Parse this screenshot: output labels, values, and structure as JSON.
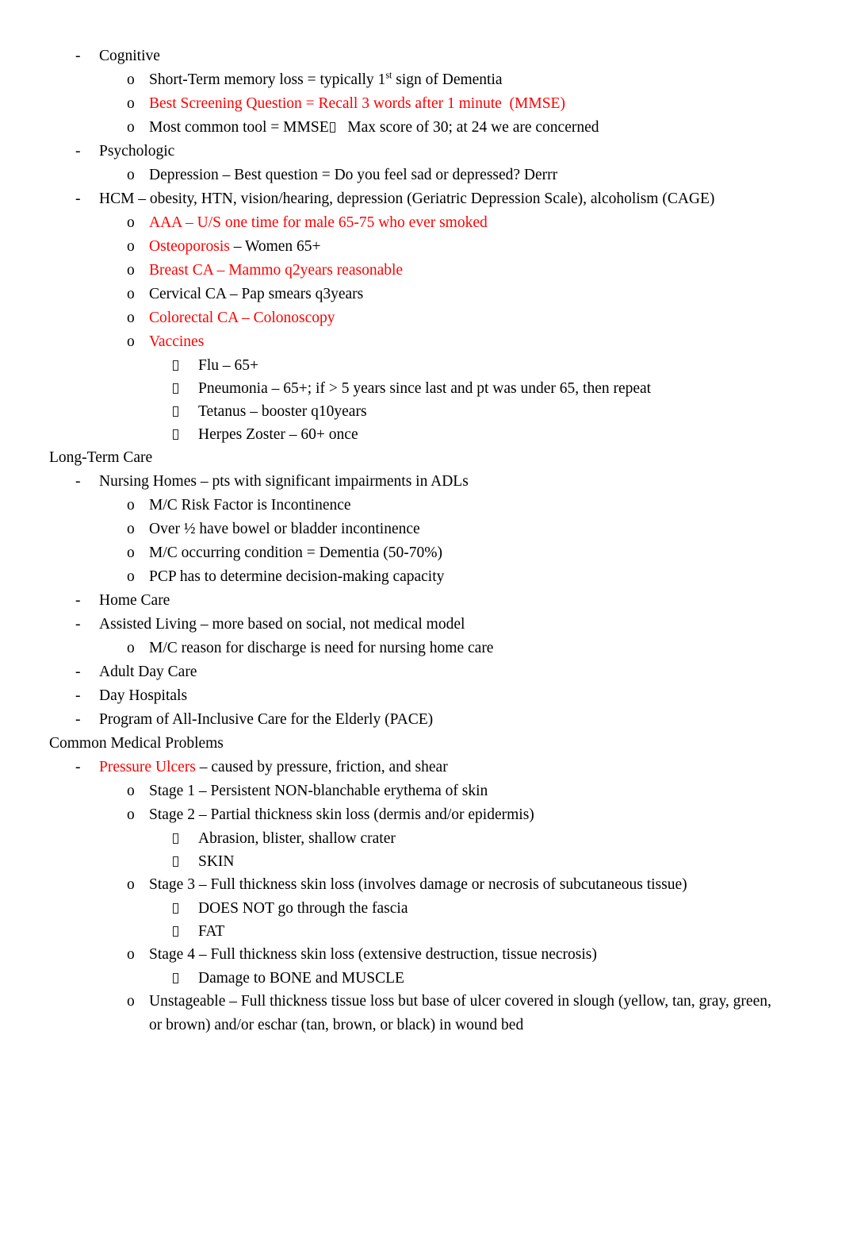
{
  "document": {
    "accent_red": "#FF0000",
    "text_black": "#000000",
    "background": "#FFFFFF",
    "missing_glyph_name": "missing-glyph-box"
  },
  "lines": [
    {
      "level": 1,
      "marker": "-",
      "name": "bullet-cognitive",
      "segments": [
        {
          "text": "Cognitive",
          "color": "black"
        }
      ]
    },
    {
      "level": 2,
      "marker": "o",
      "name": "bullet-short-term-memory-loss",
      "segments": [
        {
          "text": "Short-Term memory loss = typically 1",
          "color": "black"
        },
        {
          "text": "st",
          "color": "black",
          "sup": true
        },
        {
          "text": " sign of Dementia",
          "color": "black"
        }
      ]
    },
    {
      "level": 2,
      "marker": "o",
      "name": "bullet-best-screening-question",
      "segments": [
        {
          "text": "Best Screening Question = Recall 3 words after 1 minute  (MMSE)",
          "color": "red"
        }
      ]
    },
    {
      "level": 2,
      "marker": "o",
      "name": "bullet-most-common-tool-mmse",
      "segments": [
        {
          "text": "Most common tool = MMSE",
          "color": "black"
        },
        {
          "tofu": true
        },
        {
          "text": "   Max score of 30; at 24 we are concerned",
          "color": "black"
        }
      ]
    },
    {
      "level": 1,
      "marker": "-",
      "name": "bullet-psychologic",
      "segments": [
        {
          "text": "Psychologic",
          "color": "black"
        }
      ]
    },
    {
      "level": 2,
      "marker": "o",
      "name": "bullet-depression-best-question",
      "segments": [
        {
          "text": "Depression – Best question = Do you feel sad or depressed? Derrr",
          "color": "black"
        }
      ]
    },
    {
      "level": 1,
      "marker": "-",
      "name": "bullet-hcm",
      "segments": [
        {
          "text": "HCM – obesity, HTN, vision/hearing, depression (Geriatric Depression Scale), alcoholism (CAGE)",
          "color": "black"
        }
      ]
    },
    {
      "level": 2,
      "marker": "o",
      "name": "bullet-aaa-screening",
      "segments": [
        {
          "text": "AAA – U/S one time for male 65-75 who ever smoked",
          "color": "red"
        }
      ]
    },
    {
      "level": 2,
      "marker": "o",
      "name": "bullet-osteoporosis",
      "segments": [
        {
          "text": "Osteoporosis ",
          "color": "red"
        },
        {
          "text": "– Women 65+",
          "color": "black"
        }
      ]
    },
    {
      "level": 2,
      "marker": "o",
      "name": "bullet-breast-ca",
      "segments": [
        {
          "text": "Breast CA – Mammo q2years reasonable",
          "color": "red"
        }
      ]
    },
    {
      "level": 2,
      "marker": "o",
      "name": "bullet-cervical-ca",
      "segments": [
        {
          "text": "Cervical CA – Pap smears q3years",
          "color": "black"
        }
      ]
    },
    {
      "level": 2,
      "marker": "o",
      "name": "bullet-colorectal-ca",
      "segments": [
        {
          "text": "Colorectal CA – Colonoscopy",
          "color": "red"
        }
      ]
    },
    {
      "level": 2,
      "marker": "o",
      "name": "bullet-vaccines",
      "segments": [
        {
          "text": "Vaccines",
          "color": "red"
        }
      ]
    },
    {
      "level": 3,
      "marker": "box",
      "name": "bullet-vaccine-flu",
      "segments": [
        {
          "text": "Flu – 65+",
          "color": "black"
        }
      ]
    },
    {
      "level": 3,
      "marker": "box",
      "name": "bullet-vaccine-pneumonia",
      "segments": [
        {
          "text": "Pneumonia – 65+; if > 5 years since last and pt was under 65, then repeat",
          "color": "black"
        }
      ]
    },
    {
      "level": 3,
      "marker": "box",
      "name": "bullet-vaccine-tetanus",
      "segments": [
        {
          "text": "Tetanus – booster q10years",
          "color": "black"
        }
      ]
    },
    {
      "level": 3,
      "marker": "box",
      "name": "bullet-vaccine-herpes-zoster",
      "segments": [
        {
          "text": "Herpes Zoster – 60+ once",
          "color": "black"
        }
      ]
    },
    {
      "level": 0,
      "marker": "",
      "name": "heading-long-term-care",
      "segments": [
        {
          "text": "Long-Term Care",
          "color": "black"
        }
      ]
    },
    {
      "level": 1,
      "marker": "-",
      "name": "bullet-nursing-homes",
      "segments": [
        {
          "text": "Nursing Homes – pts with significant impairments in ADLs",
          "color": "black"
        }
      ]
    },
    {
      "level": 2,
      "marker": "o",
      "name": "bullet-mc-risk-factor-incontinence",
      "segments": [
        {
          "text": "M/C Risk Factor is Incontinence",
          "color": "black"
        }
      ]
    },
    {
      "level": 2,
      "marker": "o",
      "name": "bullet-bowel-bladder-incontinence",
      "segments": [
        {
          "text": "Over ½ have bowel or bladder incontinence",
          "color": "black"
        }
      ]
    },
    {
      "level": 2,
      "marker": "o",
      "name": "bullet-mc-occurring-condition-dementia",
      "segments": [
        {
          "text": "M/C occurring condition = Dementia (50-70%)",
          "color": "black"
        }
      ]
    },
    {
      "level": 2,
      "marker": "o",
      "name": "bullet-pcp-decision-making-capacity",
      "segments": [
        {
          "text": "PCP has to determine decision-making capacity",
          "color": "black"
        }
      ]
    },
    {
      "level": 1,
      "marker": "-",
      "name": "bullet-home-care",
      "segments": [
        {
          "text": "Home Care",
          "color": "black"
        }
      ]
    },
    {
      "level": 1,
      "marker": "-",
      "name": "bullet-assisted-living",
      "segments": [
        {
          "text": "Assisted Living – more based on social, not medical model",
          "color": "black"
        }
      ]
    },
    {
      "level": 2,
      "marker": "o",
      "name": "bullet-mc-reason-for-discharge",
      "segments": [
        {
          "text": "M/C reason for discharge is need for nursing home care",
          "color": "black"
        }
      ]
    },
    {
      "level": 1,
      "marker": "-",
      "name": "bullet-adult-day-care",
      "segments": [
        {
          "text": "Adult Day Care",
          "color": "black"
        }
      ]
    },
    {
      "level": 1,
      "marker": "-",
      "name": "bullet-day-hospitals",
      "segments": [
        {
          "text": "Day Hospitals",
          "color": "black"
        }
      ]
    },
    {
      "level": 1,
      "marker": "-",
      "name": "bullet-pace-program",
      "segments": [
        {
          "text": "Program of All-Inclusive Care for the Elderly (PACE)",
          "color": "black"
        }
      ]
    },
    {
      "level": 0,
      "marker": "",
      "name": "heading-common-medical-problems",
      "segments": [
        {
          "text": "Common Medical Problems",
          "color": "black"
        }
      ]
    },
    {
      "level": 1,
      "marker": "-",
      "name": "bullet-pressure-ulcers",
      "segments": [
        {
          "text": "Pressure Ulcers",
          "color": "red"
        },
        {
          "text": " – caused by pressure, friction, and shear",
          "color": "black"
        }
      ]
    },
    {
      "level": 2,
      "marker": "o",
      "name": "bullet-stage-1",
      "segments": [
        {
          "text": "Stage 1 – Persistent NON-blanchable erythema of skin",
          "color": "black"
        }
      ]
    },
    {
      "level": 2,
      "marker": "o",
      "name": "bullet-stage-2",
      "segments": [
        {
          "text": "Stage 2 – Partial thickness skin loss (dermis and/or epidermis)",
          "color": "black"
        }
      ]
    },
    {
      "level": 3,
      "marker": "box",
      "name": "bullet-abrasion-blister-crater",
      "segments": [
        {
          "text": "Abrasion, blister, shallow crater",
          "color": "black"
        }
      ]
    },
    {
      "level": 3,
      "marker": "box",
      "name": "bullet-skin",
      "segments": [
        {
          "text": "SKIN",
          "color": "black"
        }
      ]
    },
    {
      "level": 2,
      "marker": "o",
      "name": "bullet-stage-3",
      "segments": [
        {
          "text": "Stage 3 – Full thickness skin loss (involves damage or necrosis of subcutaneous tissue)",
          "color": "black"
        }
      ]
    },
    {
      "level": 3,
      "marker": "box",
      "name": "bullet-does-not-go-through-fascia",
      "segments": [
        {
          "text": "DOES NOT go through the fascia",
          "color": "black"
        }
      ]
    },
    {
      "level": 3,
      "marker": "box",
      "name": "bullet-fat",
      "segments": [
        {
          "text": "FAT",
          "color": "black"
        }
      ]
    },
    {
      "level": 2,
      "marker": "o",
      "name": "bullet-stage-4",
      "segments": [
        {
          "text": "Stage 4 – Full thickness skin loss (extensive destruction, tissue necrosis)",
          "color": "black"
        }
      ]
    },
    {
      "level": 3,
      "marker": "box",
      "name": "bullet-damage-to-bone-muscle",
      "segments": [
        {
          "text": "Damage to BONE and MUSCLE",
          "color": "black"
        }
      ]
    },
    {
      "level": 2,
      "marker": "o",
      "wrap": true,
      "name": "bullet-unstageable",
      "segments": [
        {
          "text": "Unstageable – Full thickness tissue loss but base of ulcer covered in slough (yellow, tan, gray, green, or brown) and/or eschar (tan, brown, or black) in wound bed",
          "color": "black"
        }
      ]
    }
  ]
}
